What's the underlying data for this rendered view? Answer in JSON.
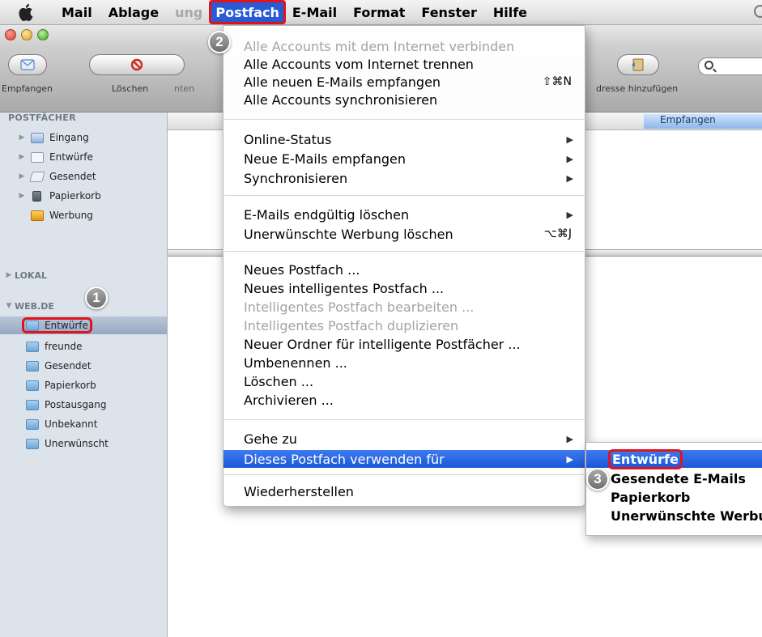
{
  "menubar": {
    "app": "Mail",
    "items": [
      "Ablage",
      "ung",
      "Postfach",
      "E-Mail",
      "Format",
      "Fenster",
      "Hilfe"
    ]
  },
  "toolbar": {
    "get_mail": "Empfangen",
    "delete": "Löschen",
    "reply_partial": "nten",
    "add_address_partial": "dresse hinzufügen"
  },
  "sidebar": {
    "mailboxes_heading": "POSTFÄCHER",
    "mailboxes": [
      "Eingang",
      "Entwürfe",
      "Gesendet",
      "Papierkorb",
      "Werbung"
    ],
    "local_heading": "LOKAL",
    "account_heading": "WEB.DE",
    "account_folders": [
      "Entwürfe",
      "freunde",
      "Gesendet",
      "Papierkorb",
      "Postausgang",
      "Unbekannt",
      "Unerwünscht"
    ]
  },
  "list": {
    "received_column": "Empfangen"
  },
  "postfach_menu": {
    "group1": [
      {
        "label": "Alle Accounts mit dem Internet verbinden",
        "disabled": true
      },
      {
        "label": "Alle Accounts vom Internet trennen"
      },
      {
        "label": "Alle neuen E-Mails empfangen",
        "shortcut": "⇧⌘N"
      },
      {
        "label": "Alle Accounts synchronisieren"
      }
    ],
    "group2": [
      {
        "label": "Online-Status"
      },
      {
        "label": "Neue E-Mails empfangen"
      },
      {
        "label": "Synchronisieren"
      }
    ],
    "group3": [
      {
        "label": "E-Mails endgültig löschen"
      },
      {
        "label": "Unerwünschte Werbung löschen",
        "shortcut": "⌥⌘J"
      }
    ],
    "group4": [
      {
        "label": "Neues Postfach ..."
      },
      {
        "label": "Neues intelligentes Postfach ..."
      },
      {
        "label": "Intelligentes Postfach bearbeiten ...",
        "disabled": true
      },
      {
        "label": "Intelligentes Postfach duplizieren",
        "disabled": true
      },
      {
        "label": "Neuer Ordner für intelligente Postfächer ..."
      },
      {
        "label": "Umbenennen ..."
      },
      {
        "label": "Löschen ..."
      },
      {
        "label": "Archivieren ..."
      }
    ],
    "group5": [
      {
        "label": "Gehe zu"
      },
      {
        "label": "Dieses Postfach verwenden für"
      }
    ],
    "group6": [
      {
        "label": "Wiederherstellen"
      }
    ]
  },
  "use_for_submenu": [
    "Entwürfe",
    "Gesendete E-Mails",
    "Papierkorb",
    "Unerwünschte Werbu"
  ],
  "steps": [
    "1",
    "2",
    "3"
  ],
  "colors": {
    "highlight": "#1a57d9",
    "annotation_red": "#e0141e",
    "sidebar_bg": "#dde3ea"
  }
}
